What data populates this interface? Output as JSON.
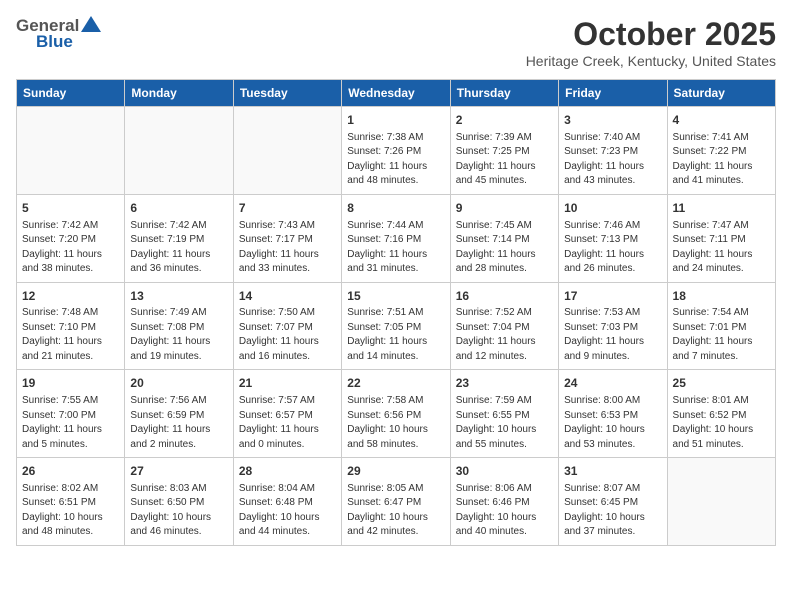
{
  "header": {
    "logo_general": "General",
    "logo_blue": "Blue",
    "month": "October 2025",
    "location": "Heritage Creek, Kentucky, United States"
  },
  "weekdays": [
    "Sunday",
    "Monday",
    "Tuesday",
    "Wednesday",
    "Thursday",
    "Friday",
    "Saturday"
  ],
  "weeks": [
    [
      {
        "day": "",
        "info": ""
      },
      {
        "day": "",
        "info": ""
      },
      {
        "day": "",
        "info": ""
      },
      {
        "day": "1",
        "info": "Sunrise: 7:38 AM\nSunset: 7:26 PM\nDaylight: 11 hours\nand 48 minutes."
      },
      {
        "day": "2",
        "info": "Sunrise: 7:39 AM\nSunset: 7:25 PM\nDaylight: 11 hours\nand 45 minutes."
      },
      {
        "day": "3",
        "info": "Sunrise: 7:40 AM\nSunset: 7:23 PM\nDaylight: 11 hours\nand 43 minutes."
      },
      {
        "day": "4",
        "info": "Sunrise: 7:41 AM\nSunset: 7:22 PM\nDaylight: 11 hours\nand 41 minutes."
      }
    ],
    [
      {
        "day": "5",
        "info": "Sunrise: 7:42 AM\nSunset: 7:20 PM\nDaylight: 11 hours\nand 38 minutes."
      },
      {
        "day": "6",
        "info": "Sunrise: 7:42 AM\nSunset: 7:19 PM\nDaylight: 11 hours\nand 36 minutes."
      },
      {
        "day": "7",
        "info": "Sunrise: 7:43 AM\nSunset: 7:17 PM\nDaylight: 11 hours\nand 33 minutes."
      },
      {
        "day": "8",
        "info": "Sunrise: 7:44 AM\nSunset: 7:16 PM\nDaylight: 11 hours\nand 31 minutes."
      },
      {
        "day": "9",
        "info": "Sunrise: 7:45 AM\nSunset: 7:14 PM\nDaylight: 11 hours\nand 28 minutes."
      },
      {
        "day": "10",
        "info": "Sunrise: 7:46 AM\nSunset: 7:13 PM\nDaylight: 11 hours\nand 26 minutes."
      },
      {
        "day": "11",
        "info": "Sunrise: 7:47 AM\nSunset: 7:11 PM\nDaylight: 11 hours\nand 24 minutes."
      }
    ],
    [
      {
        "day": "12",
        "info": "Sunrise: 7:48 AM\nSunset: 7:10 PM\nDaylight: 11 hours\nand 21 minutes."
      },
      {
        "day": "13",
        "info": "Sunrise: 7:49 AM\nSunset: 7:08 PM\nDaylight: 11 hours\nand 19 minutes."
      },
      {
        "day": "14",
        "info": "Sunrise: 7:50 AM\nSunset: 7:07 PM\nDaylight: 11 hours\nand 16 minutes."
      },
      {
        "day": "15",
        "info": "Sunrise: 7:51 AM\nSunset: 7:05 PM\nDaylight: 11 hours\nand 14 minutes."
      },
      {
        "day": "16",
        "info": "Sunrise: 7:52 AM\nSunset: 7:04 PM\nDaylight: 11 hours\nand 12 minutes."
      },
      {
        "day": "17",
        "info": "Sunrise: 7:53 AM\nSunset: 7:03 PM\nDaylight: 11 hours\nand 9 minutes."
      },
      {
        "day": "18",
        "info": "Sunrise: 7:54 AM\nSunset: 7:01 PM\nDaylight: 11 hours\nand 7 minutes."
      }
    ],
    [
      {
        "day": "19",
        "info": "Sunrise: 7:55 AM\nSunset: 7:00 PM\nDaylight: 11 hours\nand 5 minutes."
      },
      {
        "day": "20",
        "info": "Sunrise: 7:56 AM\nSunset: 6:59 PM\nDaylight: 11 hours\nand 2 minutes."
      },
      {
        "day": "21",
        "info": "Sunrise: 7:57 AM\nSunset: 6:57 PM\nDaylight: 11 hours\nand 0 minutes."
      },
      {
        "day": "22",
        "info": "Sunrise: 7:58 AM\nSunset: 6:56 PM\nDaylight: 10 hours\nand 58 minutes."
      },
      {
        "day": "23",
        "info": "Sunrise: 7:59 AM\nSunset: 6:55 PM\nDaylight: 10 hours\nand 55 minutes."
      },
      {
        "day": "24",
        "info": "Sunrise: 8:00 AM\nSunset: 6:53 PM\nDaylight: 10 hours\nand 53 minutes."
      },
      {
        "day": "25",
        "info": "Sunrise: 8:01 AM\nSunset: 6:52 PM\nDaylight: 10 hours\nand 51 minutes."
      }
    ],
    [
      {
        "day": "26",
        "info": "Sunrise: 8:02 AM\nSunset: 6:51 PM\nDaylight: 10 hours\nand 48 minutes."
      },
      {
        "day": "27",
        "info": "Sunrise: 8:03 AM\nSunset: 6:50 PM\nDaylight: 10 hours\nand 46 minutes."
      },
      {
        "day": "28",
        "info": "Sunrise: 8:04 AM\nSunset: 6:48 PM\nDaylight: 10 hours\nand 44 minutes."
      },
      {
        "day": "29",
        "info": "Sunrise: 8:05 AM\nSunset: 6:47 PM\nDaylight: 10 hours\nand 42 minutes."
      },
      {
        "day": "30",
        "info": "Sunrise: 8:06 AM\nSunset: 6:46 PM\nDaylight: 10 hours\nand 40 minutes."
      },
      {
        "day": "31",
        "info": "Sunrise: 8:07 AM\nSunset: 6:45 PM\nDaylight: 10 hours\nand 37 minutes."
      },
      {
        "day": "",
        "info": ""
      }
    ]
  ]
}
